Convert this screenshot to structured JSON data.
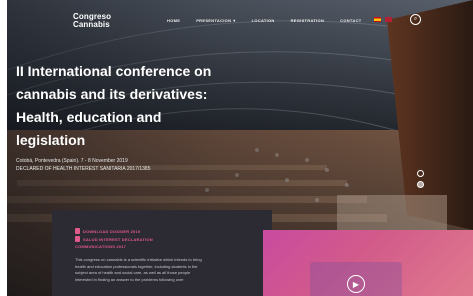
{
  "header": {
    "logo_line1": "Congreso",
    "logo_line2": "Cannabis",
    "nav": [
      {
        "label": "HOME",
        "has_dropdown": false
      },
      {
        "label": "PRESENTACION",
        "has_dropdown": true
      },
      {
        "label": "LOCATION",
        "has_dropdown": false
      },
      {
        "label": "REGISTRATION",
        "has_dropdown": false
      },
      {
        "label": "CONTACT",
        "has_dropdown": false
      }
    ],
    "languages": [
      "es",
      "en"
    ],
    "search_icon": "search-icon"
  },
  "hero": {
    "title_lines": [
      "II International conference on",
      "cannabis and its derivatives:",
      "Health, education and",
      "legislation"
    ],
    "subtitle_lines": [
      "Cotobá, Pontevedra (Spain). 7 - 8 November 2019",
      "DECLARED OF HEALTH INTEREST SANITARIA 2017/1385"
    ],
    "slider_count": 2,
    "slider_active": 1
  },
  "info": {
    "links": [
      "Download Dossier 2019",
      "SALUD INTEREST DECLARATION",
      "COMMUNICATIONS 2017"
    ],
    "text_lines": [
      "This congress on cannabis is a scientific initiative which intends to bring",
      "health and education professionals together, including students in the",
      "subject area of health and social care, as well as all those people",
      "interested in finding an answer to the problems following over"
    ]
  },
  "video": {
    "play_icon": "play-icon"
  },
  "colors": {
    "accent_pink": "#e05a8b",
    "card_dark": "#2c2a33",
    "video_gradient_start": "#c94aa0",
    "video_gradient_end": "#e07a8e"
  }
}
